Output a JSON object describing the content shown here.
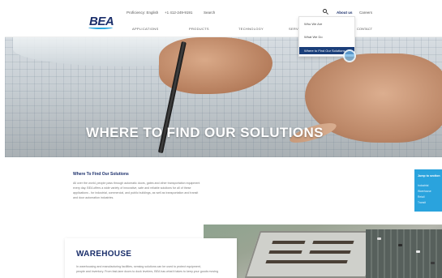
{
  "header": {
    "logo": "BEA",
    "language_selector": "Proficiency: English",
    "phone": "+1 412-249-9191",
    "search_label": "Search",
    "about_us": "About us",
    "careers": "Careers",
    "nav": [
      "APPLICATIONS",
      "PRODUCTS",
      "TECHNOLOGY",
      "SERVI...",
      "CONTACT"
    ]
  },
  "dropdown": {
    "items": [
      "Who We Are",
      "What We Do",
      "Where to Find Our Solutions"
    ],
    "active_index": 2
  },
  "hero": {
    "title": "WHERE TO FIND OUR SOLUTIONS"
  },
  "section": {
    "title": "Where To Find Our Solutions",
    "lines": [
      "All over the world, people pass through automatic doors, gates and other transportation equipment",
      "every day. BEA offers a wide variety of innovative, safe and reliable solutions for all of these",
      "applications - for industrial, commercial, and public buildings, as well as transportation and transit",
      "and door automation industries."
    ]
  },
  "side_panel": {
    "title": "Jump to section",
    "links": [
      "Industrial",
      "Warehouse",
      "Retail",
      "Transit"
    ]
  },
  "warehouse": {
    "title": "WAREHOUSE",
    "lines": [
      "In warehousing and manufacturing facilities, sensing solutions can be used to protect equipment,",
      "people and inventory. From fast-lane doors to dock levelers, BEA has what it takes to keep your goods moving"
    ]
  },
  "colors": {
    "brand": "#1b2f6b",
    "accent": "#29a8e0",
    "menu_active": "#1b3f7a"
  }
}
